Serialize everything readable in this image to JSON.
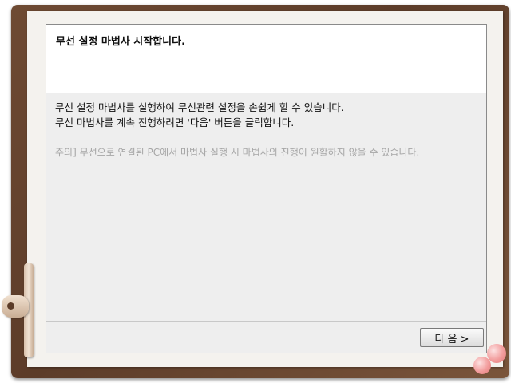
{
  "wizard": {
    "title": "무선 설정 마법사 시작합니다.",
    "body": {
      "line1": "무선 설정 마법사를 실행하여 무선관련 설정을 손쉽게 할 수 있습니다.",
      "line2": "무선 마법사를 계속 진행하려면 '다음' 버튼을 클릭합니다.",
      "note": "주의] 무선으로 연결된 PC에서 마법사 실행 시 마법사의 진행이 원활하지 않을 수 있습니다."
    },
    "footer": {
      "next_label": "다 음 >"
    }
  },
  "decor": {
    "frame_color": "#5c3c29",
    "paper_color": "#f4f2ee",
    "ball_color": "#f29c9c"
  }
}
